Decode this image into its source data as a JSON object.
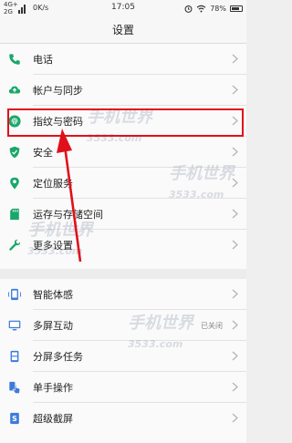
{
  "status_bar": {
    "signal_top": "4G+",
    "signal_bottom": "2G",
    "net_speed": "0K/s",
    "time": "17:05",
    "battery": "78%"
  },
  "header": {
    "title": "设置"
  },
  "menu": [
    {
      "label": "电话",
      "icon": "phone-icon"
    },
    {
      "label": "帐户与同步",
      "icon": "cloud-sync-icon"
    },
    {
      "label": "指纹与密码",
      "icon": "fingerprint-icon"
    },
    {
      "label": "安全",
      "icon": "shield-icon"
    },
    {
      "label": "定位服务",
      "icon": "location-icon"
    },
    {
      "label": "运存与存储空间",
      "icon": "sd-card-icon"
    },
    {
      "label": "更多设置",
      "icon": "wrench-icon"
    },
    {
      "label": "智能体感",
      "icon": "motion-icon"
    },
    {
      "label": "多屏互动",
      "icon": "multi-screen-icon"
    },
    {
      "label": "分屏多任务",
      "icon": "split-screen-icon"
    },
    {
      "label": "单手操作",
      "icon": "one-hand-icon"
    },
    {
      "label": "超级截屏",
      "icon": "screenshot-icon"
    }
  ],
  "multi_screen_status": "已关闭",
  "watermark": {
    "brand": "手机世界",
    "domain": "3533.com"
  },
  "colors": {
    "accent": "#1aa76a",
    "highlight": "#e0101a",
    "blue_icon": "#3d7bd9"
  }
}
